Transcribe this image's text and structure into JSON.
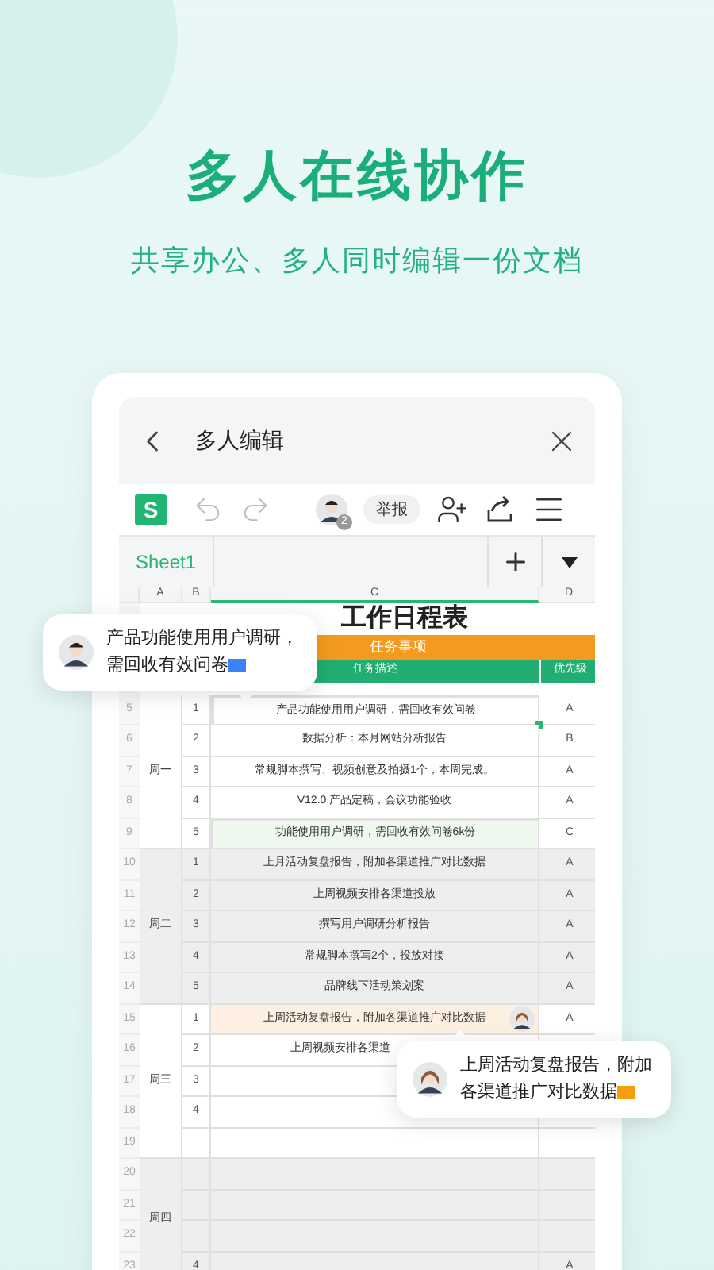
{
  "headline": "多人在线协作",
  "subheadline": "共享办公、多人同时编辑一份文档",
  "window": {
    "title": "多人编辑"
  },
  "toolbar": {
    "app_logo": "S",
    "collaborator_count": "2",
    "report_button": "举报"
  },
  "sheet_tabs": [
    {
      "label": "Sheet1",
      "selected": true
    }
  ],
  "columns": [
    {
      "label": "A",
      "selected": false
    },
    {
      "label": "B",
      "selected": false
    },
    {
      "label": "C",
      "selected": true
    },
    {
      "label": "D",
      "selected": false
    }
  ],
  "sheet": {
    "title": "工作日程表",
    "section": "任务事项",
    "header_desc": "任务描述",
    "header_priority": "优先级"
  },
  "groups": [
    {
      "label": "周一",
      "shaded": false,
      "rows": [
        {
          "num": "5",
          "b": "1",
          "c": "产品功能使用用户调研，需回收有效问卷",
          "d": "A",
          "kind": "selected"
        },
        {
          "num": "6",
          "b": "2",
          "c": "数据分析：本月网站分析报告",
          "d": "B",
          "kind": "plain"
        },
        {
          "num": "7",
          "b": "3",
          "c": "常规脚本撰写、视频创意及拍摄1个，本周完成。",
          "d": "A",
          "kind": "plain"
        },
        {
          "num": "8",
          "b": "4",
          "c": "V12.0 产品定稿，会议功能验收",
          "d": "A",
          "kind": "plain"
        },
        {
          "num": "9",
          "b": "5",
          "c": "功能使用用户调研，需回收有效问卷6k份",
          "d": "C",
          "kind": "green"
        }
      ]
    },
    {
      "label": "周二",
      "shaded": true,
      "rows": [
        {
          "num": "10",
          "b": "1",
          "c": "上月活动复盘报告，附加各渠道推广对比数据",
          "d": "A",
          "kind": "plain"
        },
        {
          "num": "11",
          "b": "2",
          "c": "上周视频安排各渠道投放",
          "d": "A",
          "kind": "plain"
        },
        {
          "num": "12",
          "b": "3",
          "c": "撰写用户调研分析报告",
          "d": "A",
          "kind": "plain"
        },
        {
          "num": "13",
          "b": "4",
          "c": "常规脚本撰写2个，投放对接",
          "d": "A",
          "kind": "plain"
        },
        {
          "num": "14",
          "b": "5",
          "c": "品牌线下活动策划案",
          "d": "A",
          "kind": "plain"
        }
      ]
    },
    {
      "label": "周三",
      "shaded": false,
      "rows": [
        {
          "num": "15",
          "b": "1",
          "c": "上周活动复盘报告，附加各渠道推广对比数据",
          "d": "A",
          "kind": "editing"
        },
        {
          "num": "16",
          "b": "2",
          "c": "上周视频安排各渠道",
          "kind": "covered"
        },
        {
          "num": "17",
          "b": "3",
          "kind": "plain"
        },
        {
          "num": "18",
          "b": "4",
          "kind": "plain"
        },
        {
          "num": "19",
          "kind": "plain"
        }
      ]
    },
    {
      "label": "周四",
      "shaded": true,
      "rows": [
        {
          "num": "20",
          "kind": "plain"
        },
        {
          "num": "21",
          "kind": "plain"
        },
        {
          "num": "22",
          "kind": "plain"
        },
        {
          "num": "23",
          "b": "4",
          "d": "A",
          "kind": "plain"
        }
      ]
    }
  ],
  "comments": [
    {
      "text": "产品功能使用用户调研，需回收有效问卷",
      "color": "#3b82f6"
    },
    {
      "text": "上周活动复盘报告，附加各渠道推广对比数据",
      "color": "#f59e0b"
    }
  ]
}
